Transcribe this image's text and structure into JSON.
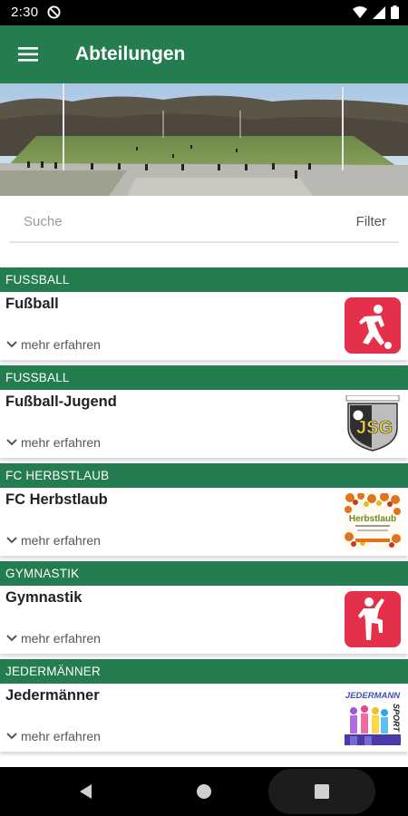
{
  "status": {
    "time": "2:30"
  },
  "appbar": {
    "title": "Abteilungen"
  },
  "search": {
    "placeholder": "Suche",
    "filter_label": "Filter"
  },
  "items": [
    {
      "category": "FUSSBALL",
      "name": "Fußball",
      "more": "mehr erfahren"
    },
    {
      "category": "FUSSBALL",
      "name": "Fußball-Jugend",
      "more": "mehr erfahren",
      "logo_text": "JSG"
    },
    {
      "category": "FC HERBSTLAUB",
      "name": "FC Herbstlaub",
      "more": "mehr erfahren",
      "logo_text": "Herbstlaub"
    },
    {
      "category": "GYMNASTIK",
      "name": "Gymnastik",
      "more": "mehr erfahren"
    },
    {
      "category": "JEDERMÄNNER",
      "name": "Jedermänner",
      "more": "mehr erfahren",
      "logo_text": "JEDERMANN",
      "logo_text2": "SPORT"
    }
  ],
  "colors": {
    "primary": "#247d4f",
    "icon_red": "#e5304b"
  },
  "icons": {
    "menu": "hamburger-icon",
    "expand": "chevron-down-icon"
  }
}
